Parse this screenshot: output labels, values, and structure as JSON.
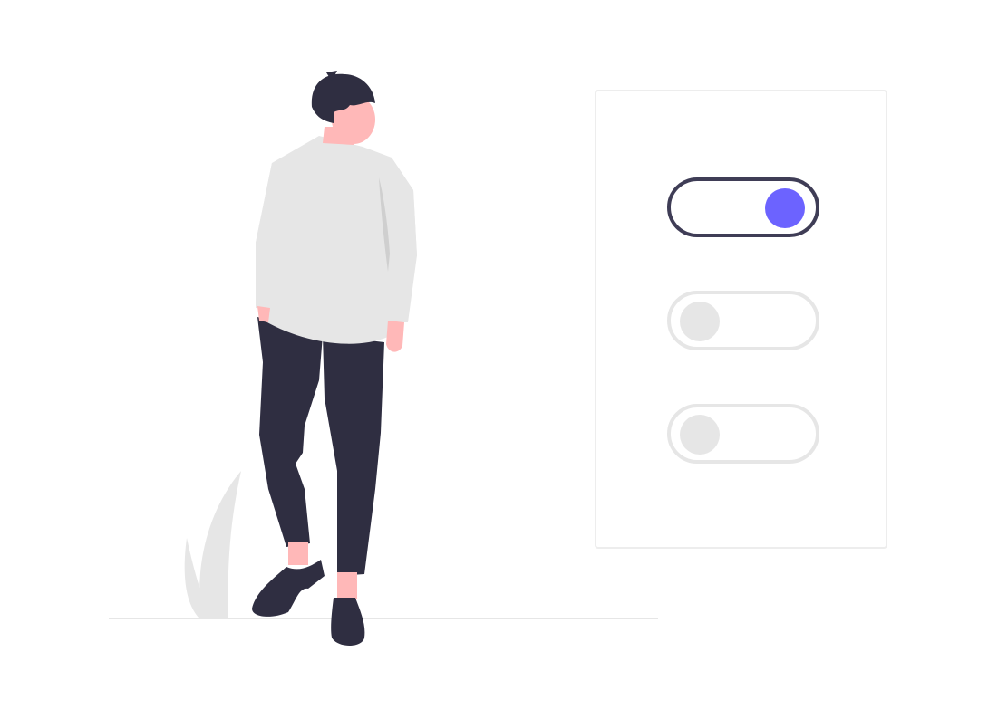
{
  "colors": {
    "accent": "#6c63ff",
    "dark": "#3f3d56",
    "pants": "#2f2e41",
    "skin": "#ffb8b8",
    "sweater": "#e6e6e6",
    "inactive": "#e6e6e6",
    "border": "#ededed"
  },
  "toggles": [
    {
      "state": "on"
    },
    {
      "state": "off"
    },
    {
      "state": "off"
    }
  ],
  "icons": {
    "person": "person-standing-illustration",
    "plant": "plant-leaf-illustration"
  }
}
